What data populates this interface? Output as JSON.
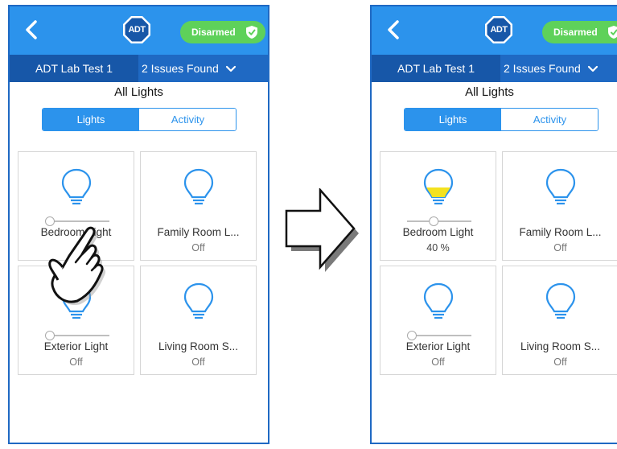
{
  "before": {
    "header": {
      "logo": "ADT",
      "status": "Disarmed"
    },
    "status_bar": {
      "site": "ADT Lab Test 1",
      "issues": "2 Issues Found"
    },
    "page_title": "All Lights",
    "tabs": [
      {
        "label": "Lights",
        "selected": true
      },
      {
        "label": "Activity",
        "selected": false
      }
    ],
    "lights": [
      {
        "name": "Bedroom Light",
        "level": 0,
        "bulb": "off"
      },
      {
        "name": "Family Room L...",
        "value": "Off",
        "bulb": "off"
      },
      {
        "name": "Exterior Light",
        "value": "Off",
        "level": 0,
        "bulb": "off"
      },
      {
        "name": "Living Room S...",
        "value": "Off",
        "bulb": "off"
      }
    ]
  },
  "after": {
    "header": {
      "logo": "ADT",
      "status": "Disarmed"
    },
    "status_bar": {
      "site": "ADT Lab Test 1",
      "issues": "2 Issues Found"
    },
    "page_title": "All Lights",
    "tabs": [
      {
        "label": "Lights",
        "selected": true
      },
      {
        "label": "Activity",
        "selected": false
      }
    ],
    "lights": [
      {
        "name": "Bedroom Light",
        "value": "40 %",
        "level": 0.4,
        "bulb": "on"
      },
      {
        "name": "Family Room L...",
        "value": "Off",
        "bulb": "off"
      },
      {
        "name": "Exterior Light",
        "value": "Off",
        "level": 0,
        "bulb": "off"
      },
      {
        "name": "Living Room S...",
        "value": "Off",
        "bulb": "off"
      }
    ]
  },
  "colors": {
    "header_blue": "#2c93ec",
    "status_bar_blue": "#1f69c3",
    "disarmed_green": "#5ed15a",
    "bulb_outline": "#2c93ec",
    "bulb_lit": "#f4e21f"
  },
  "icons": {
    "back": "chevron-left-icon",
    "logo": "adt-octagon-logo",
    "status": "shield-check-icon",
    "dropdown": "chevron-down-icon",
    "light": "lightbulb-icon",
    "gesture": "tap-hand-icon",
    "transition": "right-arrow-icon"
  }
}
